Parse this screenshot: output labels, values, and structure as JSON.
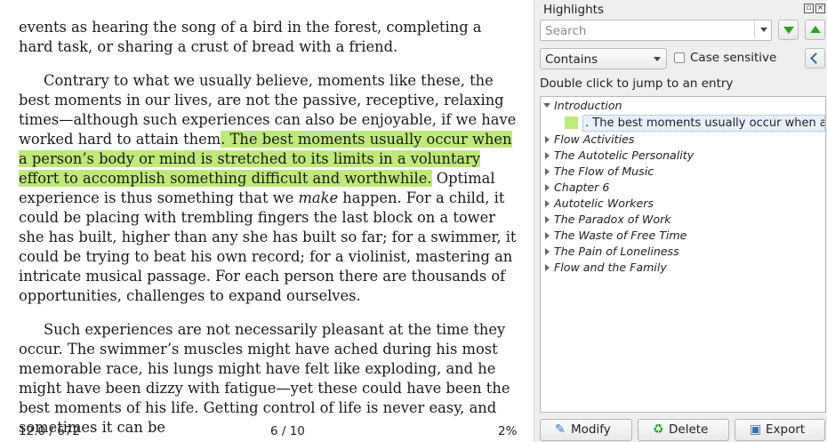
{
  "reader": {
    "para1": "events as hearing the song of a bird in the forest, completing a hard task, or sharing a crust of bread with a friend.",
    "para2_before": "Contrary to what we usually believe, moments like these, the best moments in our lives, are not the passive, receptive, relaxing times—although such experiences can also be enjoyable, if we have worked hard to attain them",
    "para2_highlight": ". The best moments usually occur when a person’s body or mind is stretched to its limits in a voluntary effort to accomplish something difficult and worthwhile.",
    "para2_mid": " Optimal experience is thus something that we ",
    "para2_italic": "make",
    "para2_after": " happen. For a child, it could be placing with trembling fingers the last block on a tower she has built, higher than any she has built so far; for a swimmer, it could be trying to beat his own record; for a violinist, mastering an intricate musical passage. For each person there are thousands of opportunities, challenges to expand ourselves.",
    "para3": "Such experiences are not necessarily pleasant at the time they occur. The swimmer’s muscles might have ached during his most memorable race, his lungs might have felt like exploding, and he might have been dizzy with fatigue—yet these could have been the best moments of his life. Getting control of life is never easy, and sometimes it can be",
    "highlight_color": "#bfe97a"
  },
  "status": {
    "position": "12.0 / 672",
    "page": "6 / 10",
    "percent": "2%"
  },
  "panel": {
    "title": "Highlights",
    "search_placeholder": "Search",
    "match_mode": "Contains",
    "case_sensitive_label": "Case sensitive",
    "case_sensitive_checked": false,
    "hint": "Double click to jump to an entry",
    "tree": {
      "expanded": {
        "label": "Introduction",
        "entry": ". The best moments usually occur when a ..."
      },
      "collapsed": [
        "Flow Activities",
        "The Autotelic Personality",
        "The Flow of Music",
        "Chapter 6",
        "Autotelic Workers",
        "The Paradox of Work",
        "The Waste of Free Time",
        "The Pain of Loneliness",
        "Flow and the Family"
      ]
    },
    "buttons": {
      "modify": "Modify",
      "delete": "Delete",
      "export": "Export"
    }
  }
}
